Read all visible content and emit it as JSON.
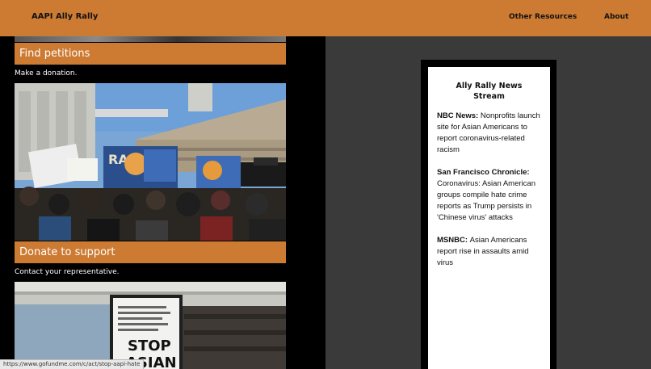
{
  "header": {
    "brand": "AAPI Ally Rally",
    "nav": {
      "other_resources": "Other Resources",
      "about": "About"
    }
  },
  "actions": {
    "find_petitions": "Find petitions",
    "make_donation_caption": "Make a donation.",
    "donate_to_support": "Donate to support",
    "contact_rep_caption": "Contact your representative."
  },
  "photos": {
    "rally_sign_left_text": "RA",
    "sign_stop": "STOP",
    "sign_asian": "ASIAN"
  },
  "news_stream": {
    "title_line1": "Ally Rally News",
    "title_line2": "Stream",
    "items": [
      {
        "source": "NBC News:",
        "headline": "Nonprofits launch site for Asian Americans to report coronavirus-related racism"
      },
      {
        "source": "San Francisco Chronicle:",
        "headline": "Coronavirus: Asian American groups compile hate crime reports as Trump persists in 'Chinese virus' attacks"
      },
      {
        "source": "MSNBC:",
        "headline": "Asian Americans report rise in assaults amid virus"
      }
    ]
  },
  "status_bar": {
    "url": "https://www.gofundme.com/c/act/stop-aapi-hate"
  },
  "colors": {
    "accent": "#cd7b32",
    "page_dark": "#3a3a3a",
    "column_black": "#000000"
  }
}
